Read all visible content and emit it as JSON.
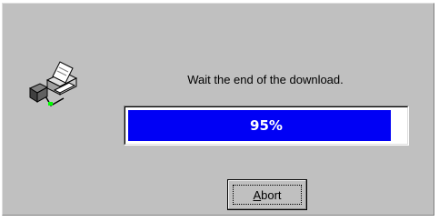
{
  "dialog": {
    "message": "Wait the end of the download.",
    "icon": "printer-network-icon"
  },
  "progress": {
    "label": "95%",
    "value": 0.95,
    "fill_color": "#0000f5"
  },
  "abort_button": {
    "label_mnemonic": "A",
    "label_rest": "bort"
  }
}
